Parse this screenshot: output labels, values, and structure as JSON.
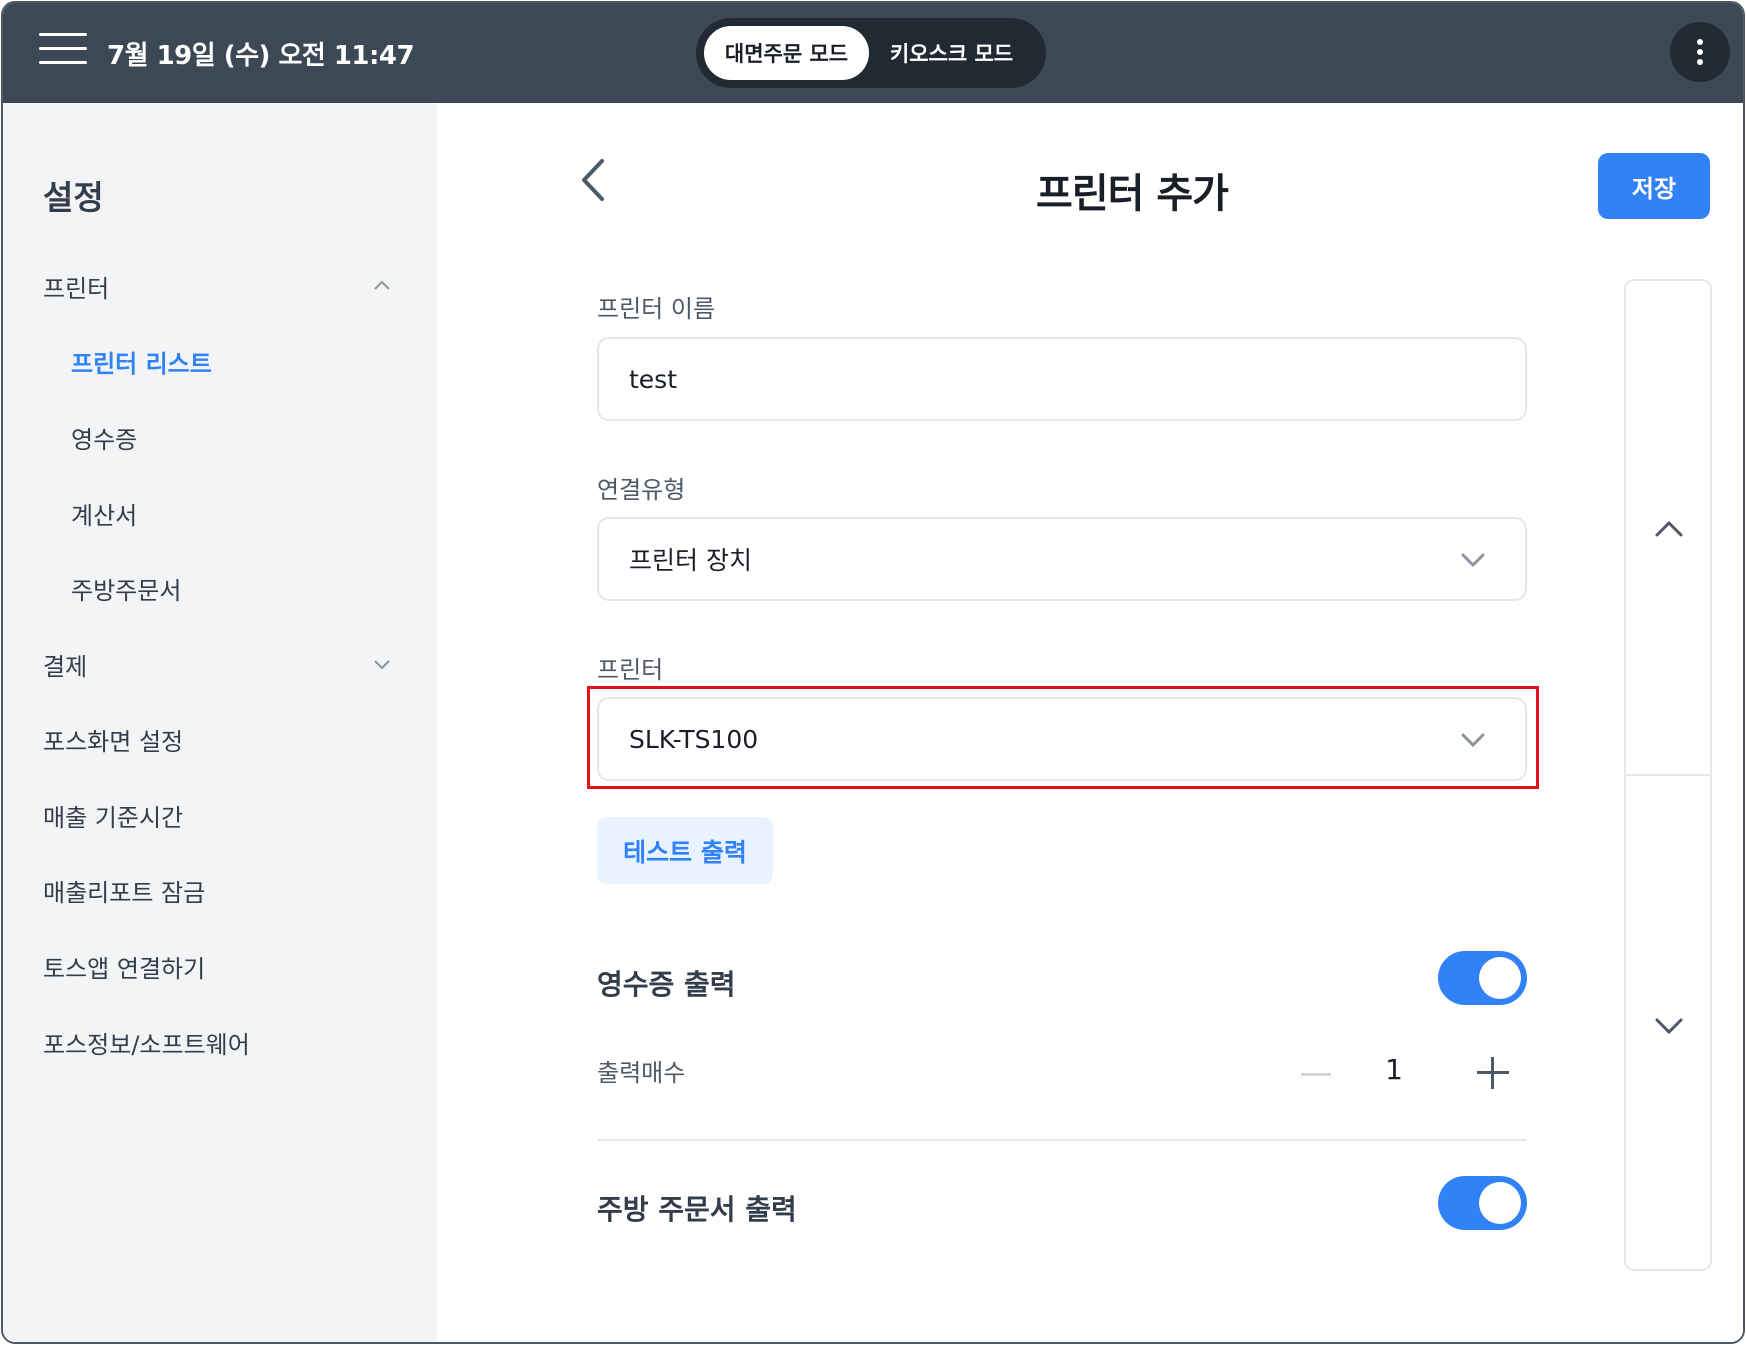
{
  "topbar": {
    "datetime": "7월 19일 (수) 오전 11:47",
    "modes": [
      "대면주문 모드",
      "키오스크 모드"
    ],
    "active_mode": "대면주문 모드"
  },
  "sidebar": {
    "title": "설정",
    "items": [
      {
        "label": "프린터",
        "expanded": true
      },
      {
        "label": "프린터 리스트",
        "selected": true
      },
      {
        "label": "영수증"
      },
      {
        "label": "계산서"
      },
      {
        "label": "주방주문서"
      },
      {
        "label": "결제",
        "expanded": false
      },
      {
        "label": "포스화면 설정"
      },
      {
        "label": "매출 기준시간"
      },
      {
        "label": "매출리포트 잠금"
      },
      {
        "label": "토스앱 연결하기"
      },
      {
        "label": "포스정보/소프트웨어"
      }
    ]
  },
  "main": {
    "title": "프린터 추가",
    "save_label": "저장",
    "printer_name_label": "프린터 이름",
    "printer_name_value": "test",
    "connection_type_label": "연결유형",
    "connection_type_value": "프린터 장치",
    "printer_label": "프린터",
    "printer_value": "SLK-TS100",
    "test_print_label": "테스트 출력",
    "receipt_print_label": "영수증 출력",
    "receipt_print_on": true,
    "print_count_label": "출력매수",
    "print_count_value": "1",
    "kitchen_print_label": "주방 주문서 출력",
    "kitchen_print_on": true
  },
  "colors": {
    "accent": "#3182f6",
    "topbar_bg": "#3c4856",
    "sidebar_bg": "#f2f4f6",
    "highlight": "#e0121b"
  },
  "icons": [
    "menu-icon",
    "more-vertical-icon",
    "chevron-left-icon",
    "chevron-up-icon",
    "chevron-down-icon",
    "minus-icon",
    "plus-icon"
  ]
}
